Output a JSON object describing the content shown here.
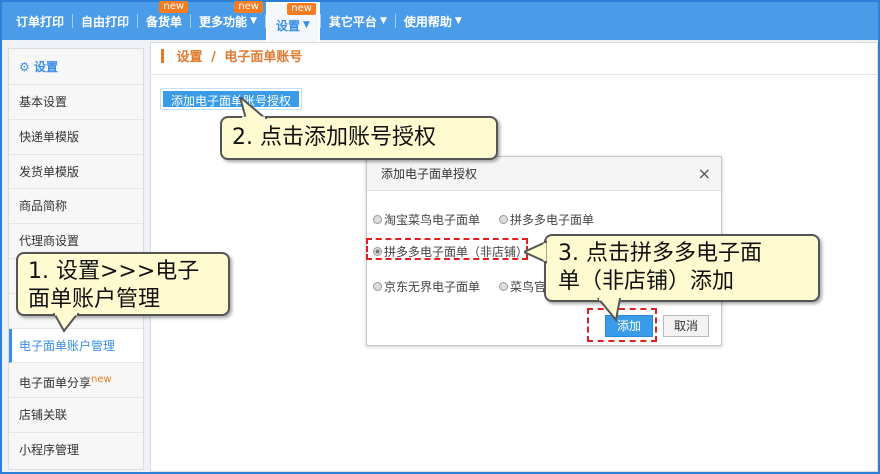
{
  "topnav": {
    "items": [
      {
        "label": "订单打印",
        "badge": "",
        "arrow": false,
        "active": false
      },
      {
        "label": "自由打印",
        "badge": "",
        "arrow": false,
        "active": false
      },
      {
        "label": "备货单",
        "badge": "new",
        "arrow": false,
        "active": false
      },
      {
        "label": "更多功能",
        "badge": "new",
        "arrow": true,
        "active": false
      },
      {
        "label": "设置",
        "badge": "new",
        "arrow": true,
        "active": true
      },
      {
        "label": "其它平台",
        "badge": "",
        "arrow": true,
        "active": false
      },
      {
        "label": "使用帮助",
        "badge": "",
        "arrow": true,
        "active": false
      }
    ],
    "arrow_glyph": "▼"
  },
  "sidebar": {
    "header_icon": "gear-icon",
    "header": "设置",
    "items": [
      {
        "label": "基本设置",
        "badge": ""
      },
      {
        "label": "快递单模版",
        "badge": ""
      },
      {
        "label": "发货单模版",
        "badge": ""
      },
      {
        "label": "商品简称",
        "badge": ""
      },
      {
        "label": "代理商设置",
        "badge": ""
      },
      {
        "label": "",
        "badge": ""
      },
      {
        "label": "",
        "badge": ""
      },
      {
        "label": "电子面单账户管理",
        "badge": ""
      },
      {
        "label": "电子面单分享",
        "badge": "new"
      },
      {
        "label": "店铺关联",
        "badge": ""
      },
      {
        "label": "小程序管理",
        "badge": ""
      }
    ]
  },
  "breadcrumb": {
    "root": "设置",
    "separator": "/",
    "current": "电子面单账号"
  },
  "add_auth_button": "添加电子面单账号授权",
  "dialog": {
    "title": "添加电子面单授权",
    "close": "×",
    "options": [
      {
        "label": "淘宝菜鸟电子面单",
        "checked": false
      },
      {
        "label": "拼多多电子面单",
        "checked": false
      },
      {
        "label": "拼多多电子面单（非店铺）",
        "checked": true
      },
      {
        "label": "京东无界电子面单",
        "checked": false
      },
      {
        "label": "菜鸟官",
        "checked": false
      }
    ],
    "ok": "添加",
    "cancel": "取消"
  },
  "callouts": {
    "step1": [
      "1. 设置>>>电子",
      "面单账户管理"
    ],
    "step2": "2. 点击添加账号授权",
    "step3": [
      "3. 点击拼多多电子面",
      "单（非店铺）添加"
    ]
  },
  "colors": {
    "nav_bg": "#4a9be8",
    "accent": "#3a8ee6",
    "badge": "#f57c20",
    "breadcrumb": "#e07a2e",
    "callout_bg": "#fffbd0",
    "highlight": "#e02020"
  }
}
